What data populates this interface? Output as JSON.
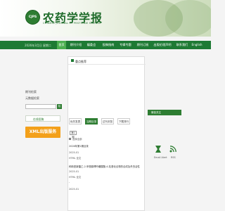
{
  "header": {
    "logo_text": "CJPS",
    "title": "农药学学报",
    "subtitle": "CHINESE JOURNAL OF PESTICIDE SCIENCE"
  },
  "nav": {
    "date": "2026年3月日 星期二",
    "items": [
      "首页",
      "期刊介绍",
      "编委会",
      "投稿指南",
      "专辑专题",
      "期刊订阅",
      "出版伦理声明",
      "联系我们",
      "English"
    ]
  },
  "left": {
    "label_1": "期刊检索",
    "label_2": "元数据检索",
    "input_placeholder": "检索",
    "search_btn": "检",
    "link_label": "在线投稿",
    "xml_label": "XML出版服务"
  },
  "panel": {
    "title": "重点推荐",
    "tabs": [
      "优先发表",
      "当期目录",
      "过刊浏览",
      "下载排行"
    ],
    "chip": "第1期",
    "select_all": "选择全部",
    "issue_title": "2026年第1期目录",
    "article_1": {
      "date": "2025-01",
      "meta": "HTML 全文"
    },
    "article_2": {
      "title": "种新型新疆乙-2-甲基腺嘌呤硼酸酯-4-羟基化合物的合成及杀虫活性",
      "date": "2025-01",
      "meta": "HTML 全文"
    },
    "article_3": {
      "title": "ʹ",
      "date": "2025-01"
    }
  },
  "right": {
    "title": "微信关注",
    "items": [
      {
        "icon": "email-icon",
        "label": "Email Alert"
      },
      {
        "icon": "rss-icon",
        "label": "RSS"
      }
    ]
  },
  "colors": {
    "brand_green": "#1e7a34",
    "accent_green": "#4caf50",
    "xml_orange": "#f3a01a"
  }
}
